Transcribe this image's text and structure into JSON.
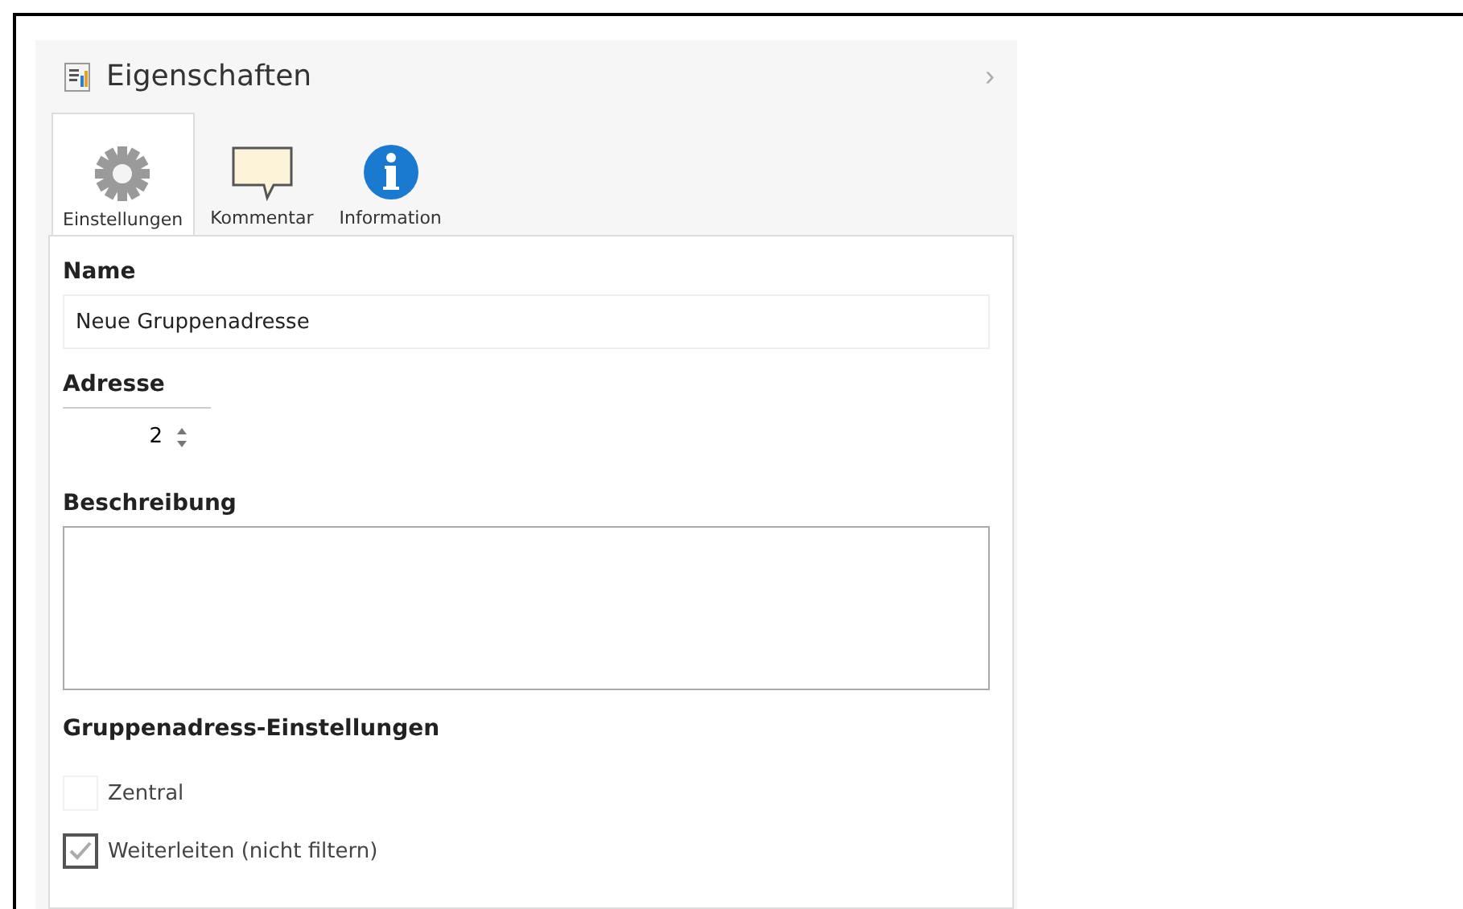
{
  "panel": {
    "title": "Eigenschaften",
    "collapse_glyph": "›"
  },
  "tabs": [
    {
      "label": "Einstellungen",
      "kind": "gear",
      "selected": true
    },
    {
      "label": "Kommentar",
      "kind": "comment",
      "selected": false
    },
    {
      "label": "Information",
      "kind": "info",
      "selected": false
    }
  ],
  "fields": {
    "name_label": "Name",
    "name_value": "Neue Gruppenadresse",
    "address_label": "Adresse",
    "address_value": "2",
    "description_label": "Beschreibung"
  },
  "group_settings": {
    "heading": "Gruppenadress-Einstellungen",
    "options": [
      {
        "label": "Zentral",
        "checked": false
      },
      {
        "label": "Weiterleiten (nicht filtern)",
        "checked": true
      }
    ]
  }
}
